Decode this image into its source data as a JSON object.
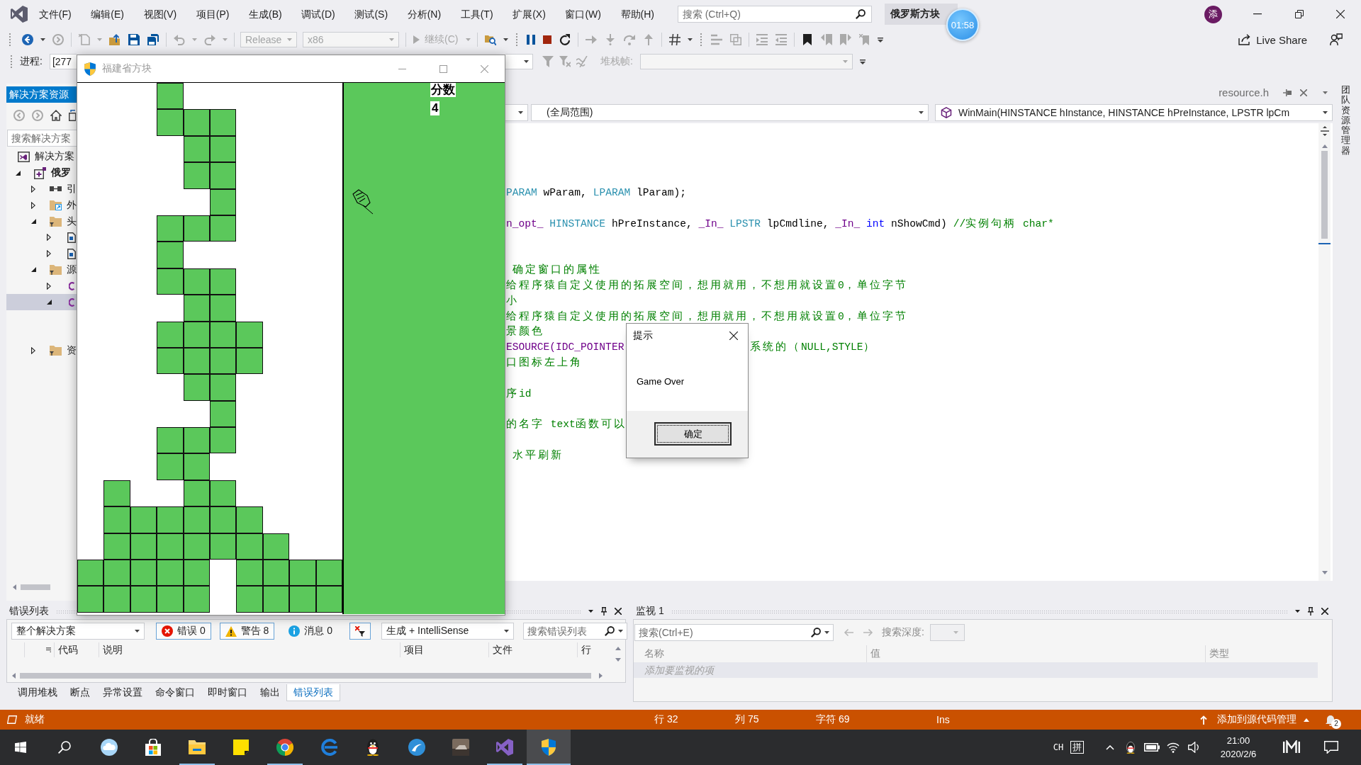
{
  "title_bar": {
    "menu": [
      "文件(F)",
      "编辑(E)",
      "视图(V)",
      "项目(P)",
      "生成(B)",
      "调试(D)",
      "测试(S)",
      "分析(N)",
      "工具(T)",
      "扩展(X)",
      "窗口(W)",
      "帮助(H)"
    ],
    "search": {
      "placeholder": "搜索 (Ctrl+Q)"
    },
    "solution_title": "俄罗斯方块",
    "account_initial": "添"
  },
  "timer_bubble": {
    "text": "01:58"
  },
  "toolbar_1": [
    {
      "kind": "back",
      "disabled": false
    },
    {
      "kind": "caret",
      "disabled": false
    },
    {
      "kind": "forward",
      "disabled": true
    },
    {
      "kind": "separator"
    },
    {
      "kind": "newfile",
      "disabled": true
    },
    {
      "kind": "caret",
      "disabled": true
    },
    {
      "kind": "open",
      "disabled": false
    },
    {
      "kind": "save",
      "disabled": false
    },
    {
      "kind": "saveall",
      "disabled": false
    },
    {
      "kind": "separator"
    },
    {
      "kind": "undo",
      "disabled": true
    },
    {
      "kind": "caret",
      "disabled": true
    },
    {
      "kind": "redo",
      "disabled": true
    },
    {
      "kind": "caret",
      "disabled": true
    },
    {
      "kind": "separator"
    },
    {
      "kind": "dropdown",
      "value": "Release",
      "disabled": true
    },
    {
      "kind": "dropdown",
      "value": "x86",
      "disabled": true
    },
    {
      "kind": "separator"
    },
    {
      "kind": "continue",
      "label": "继续(C)",
      "disabled": true
    },
    {
      "kind": "caret",
      "disabled": true
    },
    {
      "kind": "separator"
    },
    {
      "kind": "find",
      "disabled": false
    },
    {
      "kind": "caret",
      "disabled": false
    },
    {
      "kind": "grip"
    },
    {
      "kind": "pause",
      "disabled": false
    },
    {
      "kind": "stop",
      "disabled": false
    },
    {
      "kind": "restart",
      "disabled": false
    },
    {
      "kind": "separator"
    },
    {
      "kind": "shownext",
      "disabled": true
    },
    {
      "kind": "stepinto",
      "disabled": true
    },
    {
      "kind": "stepover",
      "disabled": true
    },
    {
      "kind": "stepout",
      "disabled": true
    },
    {
      "kind": "separator"
    },
    {
      "kind": "hex",
      "disabled": false
    },
    {
      "kind": "caret",
      "disabled": false
    },
    {
      "kind": "grip"
    },
    {
      "kind": "threads",
      "disabled": true
    },
    {
      "kind": "stack",
      "disabled": true
    },
    {
      "kind": "separator"
    },
    {
      "kind": "comment",
      "disabled": true
    },
    {
      "kind": "uncomment",
      "disabled": true
    },
    {
      "kind": "separator"
    },
    {
      "kind": "bookmark",
      "disabled": false
    },
    {
      "kind": "bookprev",
      "disabled": true
    },
    {
      "kind": "booknext",
      "disabled": true
    },
    {
      "kind": "bookclear",
      "disabled": true
    },
    {
      "kind": "overflow",
      "disabled": false
    }
  ],
  "live_share": {
    "label": "Live Share"
  },
  "toolbar_2": {
    "process_label": "进程:",
    "process": {
      "value": "[277"
    },
    "filters": [
      {
        "kind": "filter",
        "disabled": true
      },
      {
        "kind": "filterclear",
        "disabled": true
      },
      {
        "kind": "externalcode",
        "disabled": true
      }
    ],
    "stack_label": "堆栈帧:",
    "stack_frame": {
      "disabled": true
    }
  },
  "game_window": {
    "title": "福建省方块",
    "active": false,
    "score_label": "分数",
    "score": "4",
    "board": {
      "filled": [
        [
          false,
          false,
          false,
          true,
          false,
          false,
          false,
          false,
          false,
          false
        ],
        [
          false,
          false,
          false,
          true,
          true,
          true,
          false,
          false,
          false,
          false
        ],
        [
          false,
          false,
          false,
          false,
          true,
          true,
          false,
          false,
          false,
          false
        ],
        [
          false,
          false,
          false,
          false,
          true,
          true,
          false,
          false,
          false,
          false
        ],
        [
          false,
          false,
          false,
          false,
          false,
          true,
          false,
          false,
          false,
          false
        ],
        [
          false,
          false,
          false,
          true,
          true,
          true,
          false,
          false,
          false,
          false
        ],
        [
          false,
          false,
          false,
          true,
          false,
          false,
          false,
          false,
          false,
          false
        ],
        [
          false,
          false,
          false,
          true,
          true,
          true,
          false,
          false,
          false,
          false
        ],
        [
          false,
          false,
          false,
          false,
          true,
          true,
          false,
          false,
          false,
          false
        ],
        [
          false,
          false,
          false,
          true,
          true,
          true,
          true,
          false,
          false,
          false
        ],
        [
          false,
          false,
          false,
          true,
          true,
          true,
          true,
          false,
          false,
          false
        ],
        [
          false,
          false,
          false,
          false,
          true,
          true,
          false,
          false,
          false,
          false
        ],
        [
          false,
          false,
          false,
          false,
          false,
          true,
          false,
          false,
          false,
          false
        ],
        [
          false,
          false,
          false,
          true,
          true,
          true,
          false,
          false,
          false,
          false
        ],
        [
          false,
          false,
          false,
          true,
          true,
          false,
          false,
          false,
          false,
          false
        ],
        [
          false,
          true,
          false,
          false,
          true,
          true,
          false,
          false,
          false,
          false
        ],
        [
          false,
          true,
          true,
          true,
          true,
          true,
          true,
          false,
          false,
          false
        ],
        [
          false,
          true,
          true,
          true,
          true,
          true,
          true,
          true,
          false,
          false
        ],
        [
          true,
          true,
          true,
          true,
          true,
          false,
          true,
          true,
          true,
          true
        ],
        [
          true,
          true,
          true,
          true,
          true,
          false,
          true,
          true,
          true,
          true
        ]
      ]
    }
  },
  "solution_explorer": {
    "title": "解决方案资源",
    "search": {
      "placeholder": "搜索解决方案"
    },
    "tree": [
      {
        "kind": "solution",
        "label": "解决方案",
        "selected": false,
        "children": [
          {
            "kind": "project",
            "label": "俄罗",
            "expanded": true,
            "selected": false,
            "children": [
              {
                "kind": "references",
                "label": "引",
                "expanded": false,
                "selected": false
              },
              {
                "kind": "external",
                "label": "外",
                "expanded": false,
                "selected": false
              },
              {
                "kind": "folder",
                "label": "头",
                "expanded": true,
                "selected": false,
                "children": [
                  {
                    "kind": "header",
                    "expanded": false,
                    "selected": false
                  },
                  {
                    "kind": "header",
                    "expanded": false,
                    "selected": false
                  }
                ]
              },
              {
                "kind": "folder",
                "label": "源",
                "expanded": true,
                "selected": false,
                "children": [
                  {
                    "kind": "source",
                    "expanded": false,
                    "selected": false
                  },
                  {
                    "kind": "source",
                    "expanded": true,
                    "selected": true,
                    "children": [
                      {
                        "kind": "covered"
                      },
                      {
                        "kind": "covered"
                      }
                    ]
                  }
                ]
              },
              {
                "kind": "folder",
                "label": "资",
                "expanded": false,
                "selected": false
              }
            ]
          }
        ]
      }
    ]
  },
  "editor": {
    "tab": {
      "label": "resource.h",
      "selected": false
    },
    "scope": {
      "value": "(全局范围)"
    },
    "function": {
      "value": "WinMain(HINSTANCE hInstance, HINSTANCE hPreInstance, LPSTR lpCm"
    },
    "lines": [
      {
        "kind": "blank"
      },
      {
        "kind": "blank"
      },
      {
        "kind": "blank"
      },
      {
        "kind": "blank"
      },
      {
        "kind": "code",
        "tokens": [
          {
            "text": "PARAM",
            "kind": "type"
          },
          {
            "text": " wParam, ",
            "kind": "plain"
          },
          {
            "text": "LPARAM",
            "kind": "type"
          },
          {
            "text": " lParam);",
            "kind": "plain"
          }
        ]
      },
      {
        "kind": "blank"
      },
      {
        "kind": "code",
        "tokens": [
          {
            "text": "n_opt_ ",
            "kind": "macro"
          },
          {
            "text": "HINSTANCE",
            "kind": "type"
          },
          {
            "text": " hPreInstance, ",
            "kind": "plain"
          },
          {
            "text": "_In_ ",
            "kind": "macro"
          },
          {
            "text": "LPSTR",
            "kind": "type"
          },
          {
            "text": " lpCmdline, ",
            "kind": "plain"
          },
          {
            "text": "_In_ ",
            "kind": "macro"
          },
          {
            "text": "int",
            "kind": "keyword"
          },
          {
            "text": " nShowCmd) ",
            "kind": "plain"
          },
          {
            "text": "//实例句柄 char*",
            "kind": "comment"
          }
        ]
      },
      {
        "kind": "blank"
      },
      {
        "kind": "blank"
      },
      {
        "kind": "code",
        "tokens": [
          {
            "text": " 确定窗口的属性",
            "kind": "comment"
          }
        ]
      },
      {
        "kind": "code",
        "tokens": [
          {
            "text": "给程序猿自定义使用的拓展空间，想用就用，不想用就设置0，单位字节",
            "kind": "comment"
          }
        ]
      },
      {
        "kind": "code",
        "tokens": [
          {
            "text": "小",
            "kind": "comment"
          }
        ]
      },
      {
        "kind": "code",
        "tokens": [
          {
            "text": "给程序猿自定义使用的拓展空间，想用就用，不想用就设置0，单位字节",
            "kind": "comment"
          }
        ]
      },
      {
        "kind": "code",
        "tokens": [
          {
            "text": "景颜色",
            "kind": "comment"
          }
        ]
      },
      {
        "kind": "code",
        "tokens": [
          {
            "text": "ESOURCE(IDC_POINTER",
            "kind": "macro"
          }
        ],
        "tail": [
          {
            "text": "系统的（NULL,STYLE）",
            "kind": "comment"
          }
        ]
      },
      {
        "kind": "code",
        "tokens": [
          {
            "text": "口图标左上角",
            "kind": "comment"
          }
        ]
      },
      {
        "kind": "blank"
      },
      {
        "kind": "code",
        "tokens": [
          {
            "text": "序id",
            "kind": "comment"
          }
        ]
      },
      {
        "kind": "blank"
      },
      {
        "kind": "code",
        "tokens": [
          {
            "text": "的名字 text函数可以",
            "kind": "comment"
          }
        ]
      },
      {
        "kind": "blank"
      },
      {
        "kind": "code",
        "tokens": [
          {
            "text": " 水平刷新",
            "kind": "comment"
          }
        ]
      }
    ]
  },
  "dialog": {
    "title": "提示",
    "message": "Game Over",
    "button": "确定"
  },
  "side_tab": {
    "label": "团队资源管理器"
  },
  "error_list": {
    "title": "错误列表",
    "scope": {
      "value": "整个解决方案"
    },
    "filters": [
      {
        "kind": "error",
        "label": "错误 0",
        "on": true
      },
      {
        "kind": "warning",
        "label": "警告 8",
        "on": true
      },
      {
        "kind": "info",
        "label": "消息 0",
        "on": false
      },
      {
        "kind": "clear",
        "on": true
      }
    ],
    "source": {
      "value": "生成 + IntelliSense"
    },
    "search": {
      "placeholder": "搜索错误列表"
    },
    "columns": [
      "代码",
      "说明",
      "项目",
      "文件",
      "行"
    ],
    "tabs": [
      {
        "label": "调用堆栈",
        "selected": false
      },
      {
        "label": "断点",
        "selected": false
      },
      {
        "label": "异常设置",
        "selected": false
      },
      {
        "label": "命令窗口",
        "selected": false
      },
      {
        "label": "即时窗口",
        "selected": false
      },
      {
        "label": "输出",
        "selected": false
      },
      {
        "label": "错误列表",
        "selected": true
      }
    ]
  },
  "watch": {
    "title": "监视 1",
    "search": {
      "placeholder": "搜索(Ctrl+E)"
    },
    "history": [
      {
        "kind": "back",
        "disabled": true
      },
      {
        "kind": "forward",
        "disabled": true
      }
    ],
    "depth": {
      "label": "搜索深度:",
      "disabled": true
    },
    "columns": [
      "名称",
      "值",
      "类型"
    ],
    "add_row": {
      "placeholder": "添加要监视的项"
    }
  },
  "status_bar": {
    "state": "就绪",
    "line": "行 32",
    "column": "列 75",
    "char": "字符 69",
    "mode": "Ins",
    "source_control": "添加到源代码管理",
    "notifications": "2"
  },
  "taskbar": {
    "apps": [
      {
        "kind": "cloud",
        "running": false,
        "selected": false
      },
      {
        "kind": "store",
        "running": false,
        "selected": false
      },
      {
        "kind": "folder",
        "running": true,
        "selected": false
      },
      {
        "kind": "note",
        "running": false,
        "selected": false
      },
      {
        "kind": "ring",
        "running": true,
        "selected": false
      },
      {
        "kind": "edge",
        "running": false,
        "selected": false
      },
      {
        "kind": "penguin",
        "running": false,
        "selected": false
      },
      {
        "kind": "swirl",
        "running": false,
        "selected": false
      },
      {
        "kind": "game",
        "running": false,
        "selected": false
      },
      {
        "kind": "ribbon",
        "running": true,
        "selected": false
      },
      {
        "kind": "shield",
        "running": true,
        "selected": true
      }
    ],
    "ime": {
      "language": "CH",
      "mode": "拼"
    },
    "time": "21:00",
    "date": "2020/2/6"
  }
}
